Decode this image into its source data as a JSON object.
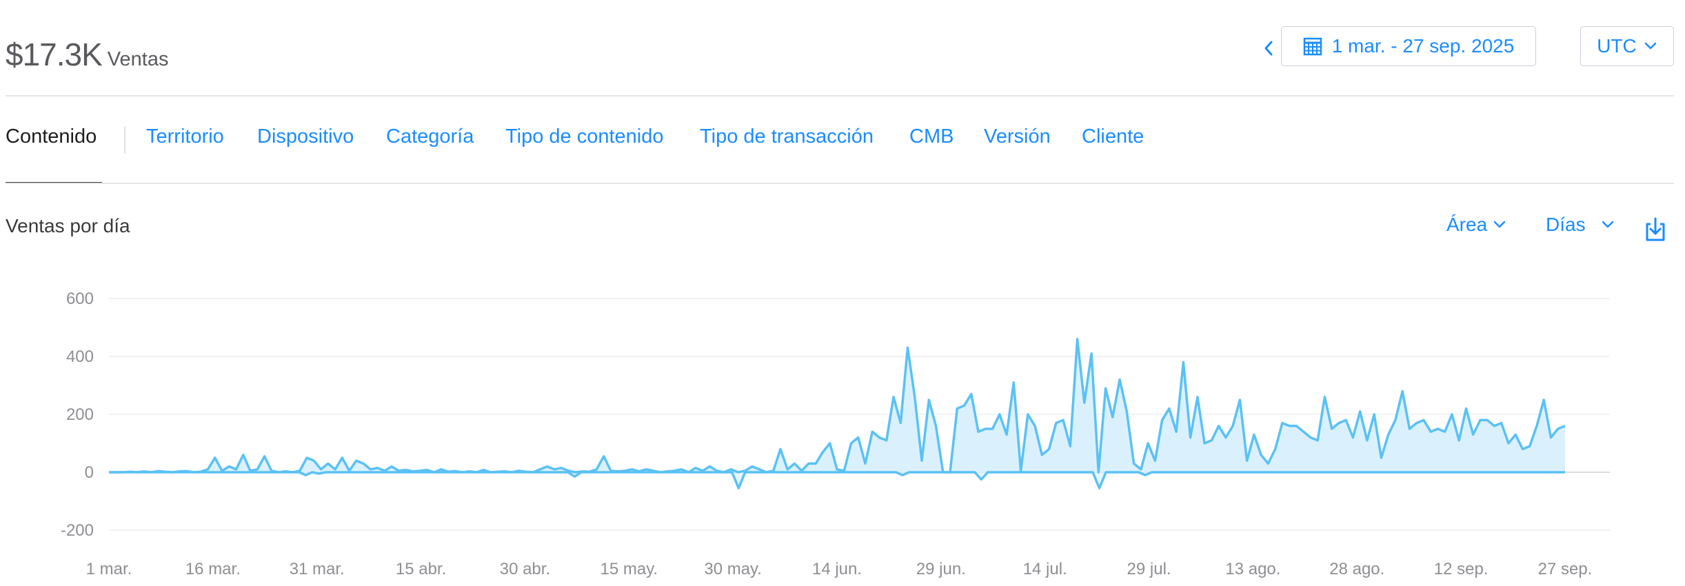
{
  "summary": {
    "value": "$17.3K",
    "label": "Ventas"
  },
  "date_range": {
    "label": "1 mar. - 27 sep. 2025"
  },
  "timezone": {
    "label": "UTC"
  },
  "tabs": [
    "Contenido",
    "Territorio",
    "Dispositivo",
    "Categoría",
    "Tipo de contenido",
    "Tipo de transacción",
    "CMB",
    "Versión",
    "Cliente"
  ],
  "active_tab": 0,
  "chart_header": {
    "title": "Ventas por día",
    "type_label": "Área",
    "interval_label": "Días"
  },
  "colors": {
    "accent": "#1a8cff",
    "series": "#5ac1f5",
    "fill": "#d6effd"
  },
  "icons": [
    "chevron-left-icon",
    "calendar-icon",
    "chevron-down-icon",
    "download-icon"
  ],
  "chart_data": {
    "type": "area",
    "title": "Ventas por día",
    "xlabel": "",
    "ylabel": "",
    "x_start": "1 mar.",
    "x_end": "27 sep.",
    "y_ticks": [
      "600",
      "400",
      "200",
      "0",
      "-200"
    ],
    "ylim": [
      -200,
      600
    ],
    "x_ticks": [
      "1 mar.",
      "16 mar.",
      "31 mar.",
      "15 abr.",
      "30 abr.",
      "15 may.",
      "30 may.",
      "14 jun.",
      "29 jun.",
      "14 jul.",
      "29 jul.",
      "13 ago.",
      "28 ago.",
      "12 sep.",
      "27 sep."
    ],
    "grid": true,
    "legend": "none",
    "series": [
      {
        "values": [
          0,
          0,
          0,
          2,
          0,
          3,
          0,
          4,
          2,
          0,
          3,
          4,
          0,
          2,
          10,
          50,
          5,
          20,
          10,
          60,
          5,
          10,
          55,
          5,
          0,
          3,
          0,
          5,
          50,
          40,
          10,
          30,
          10,
          50,
          5,
          40,
          30,
          10,
          15,
          5,
          20,
          5,
          8,
          3,
          5,
          8,
          0,
          10,
          2,
          4,
          0,
          3,
          0,
          8,
          0,
          2,
          3,
          0,
          5,
          2,
          0,
          10,
          20,
          10,
          15,
          5,
          0,
          3,
          2,
          10,
          55,
          5,
          3,
          5,
          10,
          3,
          10,
          5,
          0,
          3,
          5,
          10,
          0,
          15,
          5,
          20,
          5,
          0,
          10,
          0,
          5,
          20,
          10,
          0,
          5,
          80,
          10,
          30,
          5,
          30,
          30,
          70,
          100,
          10,
          5,
          100,
          120,
          30,
          140,
          120,
          110,
          260,
          170,
          430,
          260,
          40,
          250,
          160,
          0,
          0,
          220,
          230,
          270,
          140,
          150,
          150,
          200,
          130,
          310,
          5,
          200,
          160,
          60,
          80,
          170,
          180,
          90,
          460,
          240,
          410,
          0,
          290,
          190,
          320,
          210,
          30,
          10,
          100,
          40,
          180,
          220,
          140,
          380,
          120,
          260,
          100,
          110,
          160,
          120,
          160,
          250,
          40,
          130,
          60,
          30,
          80,
          170,
          160,
          160,
          140,
          120,
          110,
          260,
          150,
          170,
          180,
          120,
          210,
          110,
          200,
          50,
          130,
          180,
          280,
          150,
          170,
          180,
          140,
          150,
          140,
          200,
          110,
          220,
          130,
          180,
          180,
          160,
          170,
          100,
          130,
          80,
          90,
          160,
          250,
          120,
          150,
          160
        ]
      },
      {
        "values": [
          0,
          0,
          0,
          0,
          0,
          0,
          0,
          0,
          0,
          0,
          0,
          0,
          0,
          0,
          0,
          0,
          0,
          0,
          0,
          0,
          0,
          0,
          0,
          0,
          0,
          0,
          0,
          0,
          0,
          0,
          -10,
          0,
          -5,
          0,
          0,
          0,
          0,
          0,
          0,
          0,
          0,
          0,
          0,
          0,
          0,
          0,
          0,
          0,
          0,
          0,
          0,
          0,
          0,
          0,
          0,
          0,
          0,
          0,
          0,
          0,
          0,
          0,
          0,
          0,
          0,
          0,
          0,
          0,
          0,
          0,
          0,
          -15,
          0,
          0,
          0,
          0,
          0,
          0,
          0,
          0,
          0,
          0,
          0,
          0,
          0,
          0,
          0,
          0,
          0,
          0,
          0,
          0,
          0,
          0,
          0,
          0,
          -55,
          0,
          0,
          0,
          0,
          0,
          0,
          0,
          0,
          0,
          0,
          0,
          0,
          0,
          0,
          0,
          0,
          0,
          0,
          0,
          0,
          0,
          0,
          0,
          0,
          -10,
          0,
          0,
          0,
          0,
          0,
          0,
          0,
          0,
          0,
          0,
          0,
          -25,
          0,
          0,
          0,
          0,
          0,
          0,
          0,
          0,
          0,
          0,
          0,
          0,
          0,
          0,
          0,
          0,
          0,
          -55,
          0,
          0,
          0,
          0,
          0,
          0,
          -10,
          0,
          0,
          0,
          0,
          0,
          0,
          0,
          0,
          0,
          0,
          0,
          0,
          0,
          0,
          0,
          0,
          0,
          0,
          0,
          0,
          0,
          0,
          0,
          0,
          0,
          0,
          0,
          0,
          0,
          0,
          0,
          0,
          0,
          0,
          0,
          0,
          0,
          0,
          0,
          0,
          0,
          0,
          0,
          0,
          0,
          0,
          0,
          0,
          0,
          0,
          0,
          0,
          0,
          0,
          0,
          0,
          0,
          0,
          0,
          0,
          0,
          0,
          0,
          0
        ]
      }
    ]
  }
}
